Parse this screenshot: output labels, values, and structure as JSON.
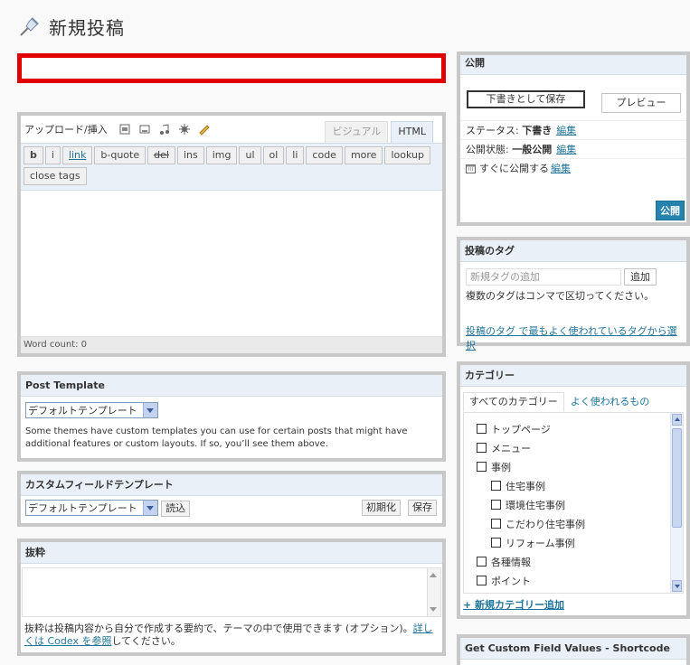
{
  "header": {
    "title": "新規投稿"
  },
  "title_input": {
    "value": "",
    "placeholder": ""
  },
  "editor": {
    "upload_label": "アップロード/挿入",
    "tabs": [
      "ビジュアル",
      "HTML"
    ],
    "active_tab": "HTML",
    "quicktags": [
      "b",
      "i",
      "link",
      "b-quote",
      "del",
      "ins",
      "img",
      "ul",
      "ol",
      "li",
      "code",
      "more",
      "lookup"
    ],
    "close_tags": "close tags",
    "content": "",
    "word_count": "Word count: 0"
  },
  "post_template": {
    "title": "Post Template",
    "selected": "デフォルトテンプレート",
    "description": "Some themes have custom templates you can use for certain posts that might have additional features or custom layouts. If so, you’ll see them above."
  },
  "custom_field_template": {
    "title": "カスタムフィールドテンプレート",
    "selected": "デフォルトテンプレート",
    "load_label": "読込",
    "reset_label": "初期化",
    "save_label": "保存"
  },
  "excerpt": {
    "title": "抜粋",
    "value": "",
    "note_before": "抜粋は投稿内容から自分で作成する要約で、テーマの中で使用できます (オプション)。",
    "note_link": "詳しくは Codex を参照",
    "note_after": "してください。"
  },
  "publish": {
    "title": "公開",
    "save_draft": "下書きとして保存",
    "preview": "プレビュー",
    "status_label": "ステータス:",
    "status_value": "下書き",
    "visibility_label": "公開状態:",
    "visibility_value": "一般公開",
    "schedule_label": "すぐに公開する",
    "edit_label": "編集",
    "publish_button": "公開"
  },
  "tags": {
    "title": "投稿のタグ",
    "placeholder": "新規タグの追加",
    "add_label": "追加",
    "hint": "複数のタグはコンマで区切ってください。",
    "popular_link": "投稿のタグ で最もよく使われているタグから選択"
  },
  "categories": {
    "title": "カテゴリー",
    "tab_all": "すべてのカテゴリー",
    "tab_popular": "よく使われるもの",
    "items": [
      {
        "label": "トップページ",
        "level": 0
      },
      {
        "label": "メニュー",
        "level": 0
      },
      {
        "label": "事例",
        "level": 0
      },
      {
        "label": "住宅事例",
        "level": 1
      },
      {
        "label": "環境住宅事例",
        "level": 1
      },
      {
        "label": "こだわり住宅事例",
        "level": 1
      },
      {
        "label": "リフォーム事例",
        "level": 1
      },
      {
        "label": "各種情報",
        "level": 0
      },
      {
        "label": "ポイント",
        "level": 0
      }
    ],
    "add_link": "+ 新規カテゴリー追加"
  },
  "custom_field_values": {
    "title": "Get Custom Field Values - Shortcode"
  }
}
